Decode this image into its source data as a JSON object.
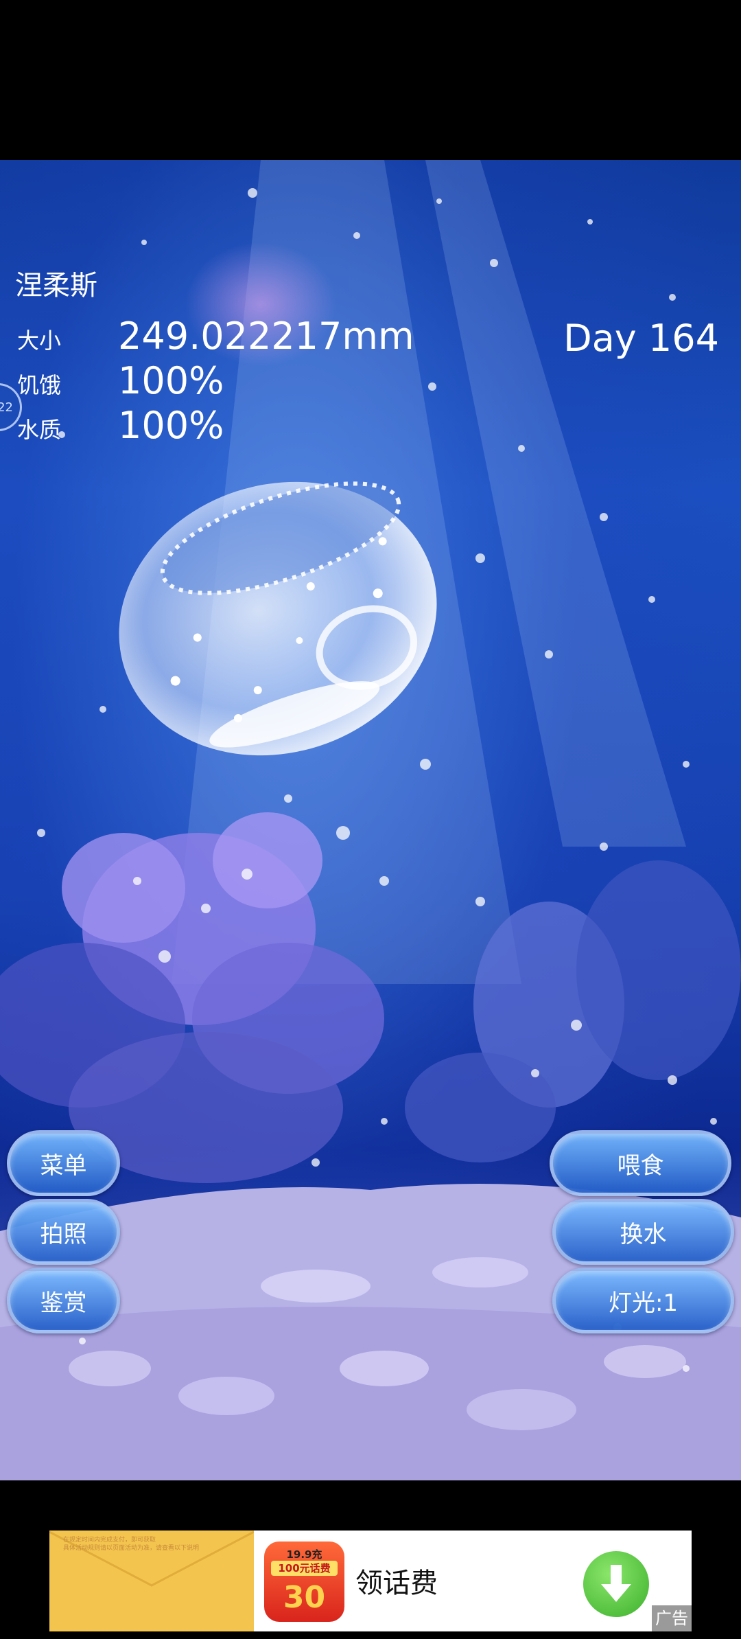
{
  "pet": {
    "name": "涅柔斯",
    "size_label": "大小",
    "size_value": "249.022217mm",
    "hunger_label": "饥饿",
    "hunger_value": "100%",
    "water_label": "水质",
    "water_value": "100%",
    "day": "Day 164"
  },
  "side_tab": {
    "text": "22"
  },
  "left_buttons": {
    "menu": "菜单",
    "photo": "拍照",
    "view": "鉴赏"
  },
  "right_buttons": {
    "feed": "喂食",
    "water": "换水",
    "light": "灯光:1"
  },
  "ad": {
    "left_line1": "在规定时间内完成支付，即可获取",
    "left_line2": "具体活动规则请以页面活动为准，请查看以下说明",
    "icon_top": "19.9充",
    "icon_strip": "100元话费",
    "icon_num": "30",
    "title": "领话费",
    "tag": "广告",
    "download_icon": "download-arrow-icon"
  },
  "colors": {
    "water_top": "#103a9c",
    "water_mid": "#1b4fc0",
    "button_border": "#aac3f0",
    "ad_panel": "#f3c54f",
    "download_green": "#3cb02c"
  }
}
